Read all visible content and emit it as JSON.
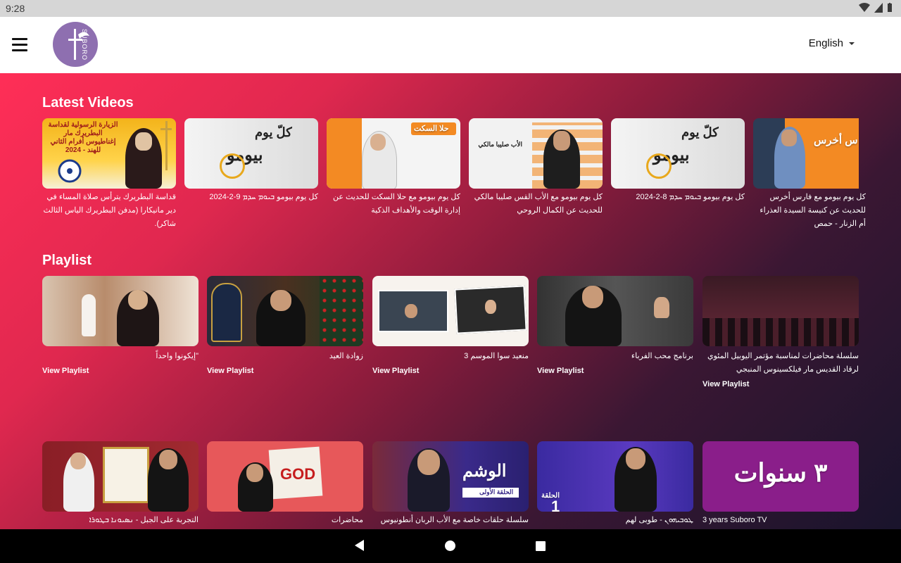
{
  "status": {
    "time": "9:28"
  },
  "header": {
    "language": "English",
    "logo_text": "SUBORO"
  },
  "latest": {
    "title": "Latest Videos",
    "items": [
      {
        "caption": "قداسة البطريرك يترأس صلاة المساء في دير مانيكارا (مدفن البطريرك الياس الثالث شاكر)."
      },
      {
        "caption": "كل يوم بيومو ܒܝܘܡ ܚܕܡ 9-2-2024"
      },
      {
        "caption": "كل يوم بيومو مع حلا السكت للحديث عن إدارة الوقت والأهداف الذكية"
      },
      {
        "caption": "كل يوم بيومو مع الأب القس صليبا مالكي للحديث عن الكمال الروحي"
      },
      {
        "caption": "كل يوم بيومو ܒܝܘܡ ܚܕܡ 8-2-2024"
      },
      {
        "caption": "كل يوم بيومو مع فارس أخرس للحديث عن كنيسة السيدة العذراء أم الزنار - حمص"
      }
    ]
  },
  "playlist": {
    "title": "Playlist",
    "view_label": "View Playlist",
    "items": [
      {
        "caption": "\"إيكونوا واحداً"
      },
      {
        "caption": "زوادة العيد"
      },
      {
        "caption": "منعيد سوا الموسم 3"
      },
      {
        "caption": "برنامج محب الفرباء"
      },
      {
        "caption": "سلسلة محاضرات لمناسبة مؤتمر اليوبيل المئوي لرقاد القديس مار فيلكسينوس المنبجي"
      }
    ]
  },
  "playlist2": {
    "items": [
      {
        "caption": "التجربة على الجبل - ܢܣܝܘܢܐ ܒܛܘܪܐ"
      },
      {
        "caption": "محاضرات"
      },
      {
        "caption": "سلسلة حلقات خاصة مع الأب الربان أنطونيوس لحدو"
      },
      {
        "caption": "ܛܘܒܝܗܘܢ - طوبى لهم"
      },
      {
        "caption": "3 years Suboro TV"
      }
    ]
  },
  "thumb_text": {
    "t1": "الزيارة الرسولية لقداسة البطريرك مار إغناطيوس أفرام الثاني للهند - 2024",
    "t2a": "كلّ يوم",
    "t2b": "بيومو",
    "t3": "حلا السكت",
    "t4": "الأب صليبا مالكي",
    "t5a": "كلّ يوم",
    "t5b": "بيومو",
    "t6": "س أخرس",
    "p3b": "GOD",
    "p3c": "الوشم",
    "p3c_sub": "الحلقة الأولى",
    "p4": "الحلقة",
    "p4_num": "1",
    "p5": "٣ سنوات"
  },
  "colors": {
    "gradient_start": "#ff2e57",
    "gradient_end": "#19142c",
    "logo_bg": "#8e6fb0"
  }
}
